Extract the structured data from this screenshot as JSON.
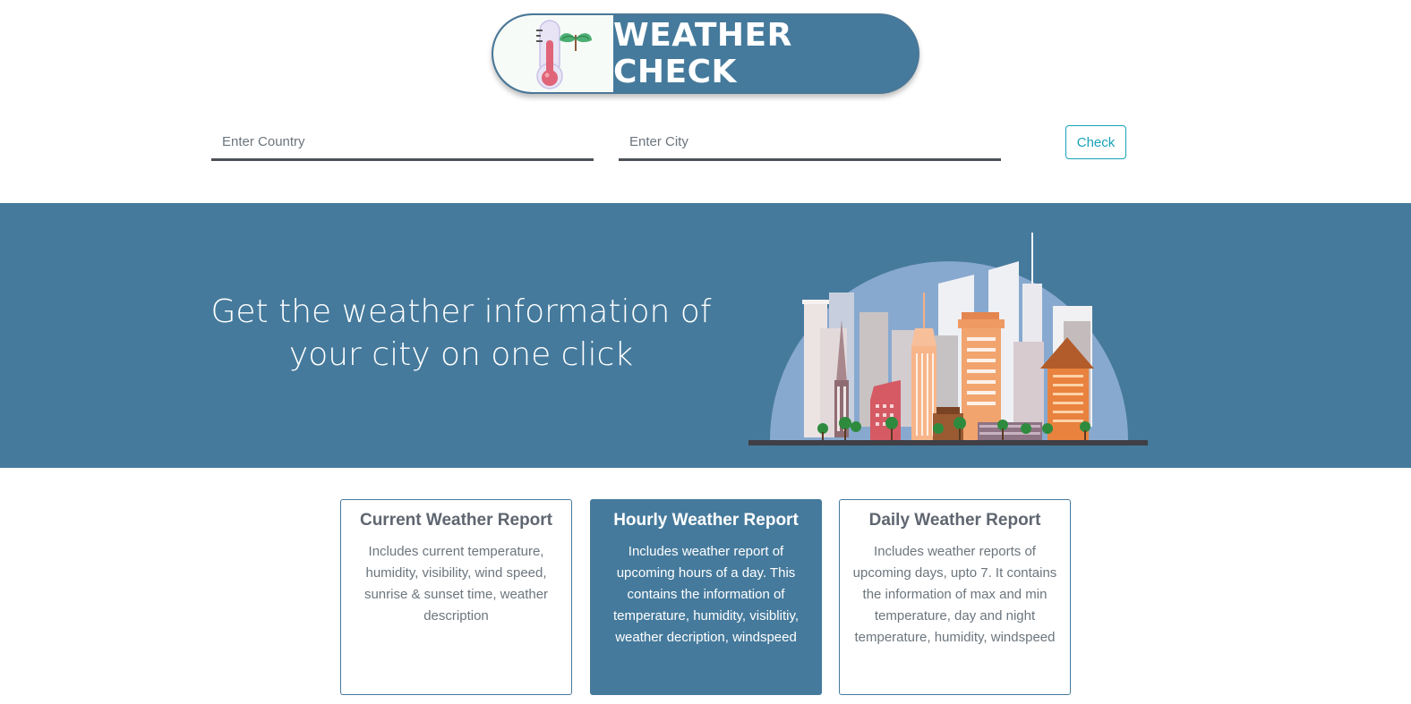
{
  "header": {
    "title": "WEATHER CHECK",
    "logo_icon": "thermometer-sprout-icon"
  },
  "search": {
    "country_placeholder": "Enter Country",
    "city_placeholder": "Enter City",
    "check_label": "Check"
  },
  "hero": {
    "line1": "Get the weather information of",
    "line2": "your city on one click",
    "illustration": "city-skyline-illustration"
  },
  "cards": [
    {
      "title": "Current Weather Report",
      "text": "Includes current temperature, humidity, visibility, wind speed, sunrise & sunset time, weather description",
      "active": false
    },
    {
      "title": "Hourly Weather Report",
      "text": "Includes weather report of upcoming hours of a day. This contains the information of temperature, humidity, visiblitiy, weather decription, windspeed",
      "active": true
    },
    {
      "title": "Daily Weather Report",
      "text": "Includes weather reports of upcoming days, upto 7. It contains the information of max and min temperature, day and night temperature, humidity, windspeed",
      "active": false
    }
  ],
  "colors": {
    "primary": "#457a9c",
    "accent_button": "#17a2b8",
    "underline": "#4c5057",
    "muted_text": "#6c757d"
  }
}
